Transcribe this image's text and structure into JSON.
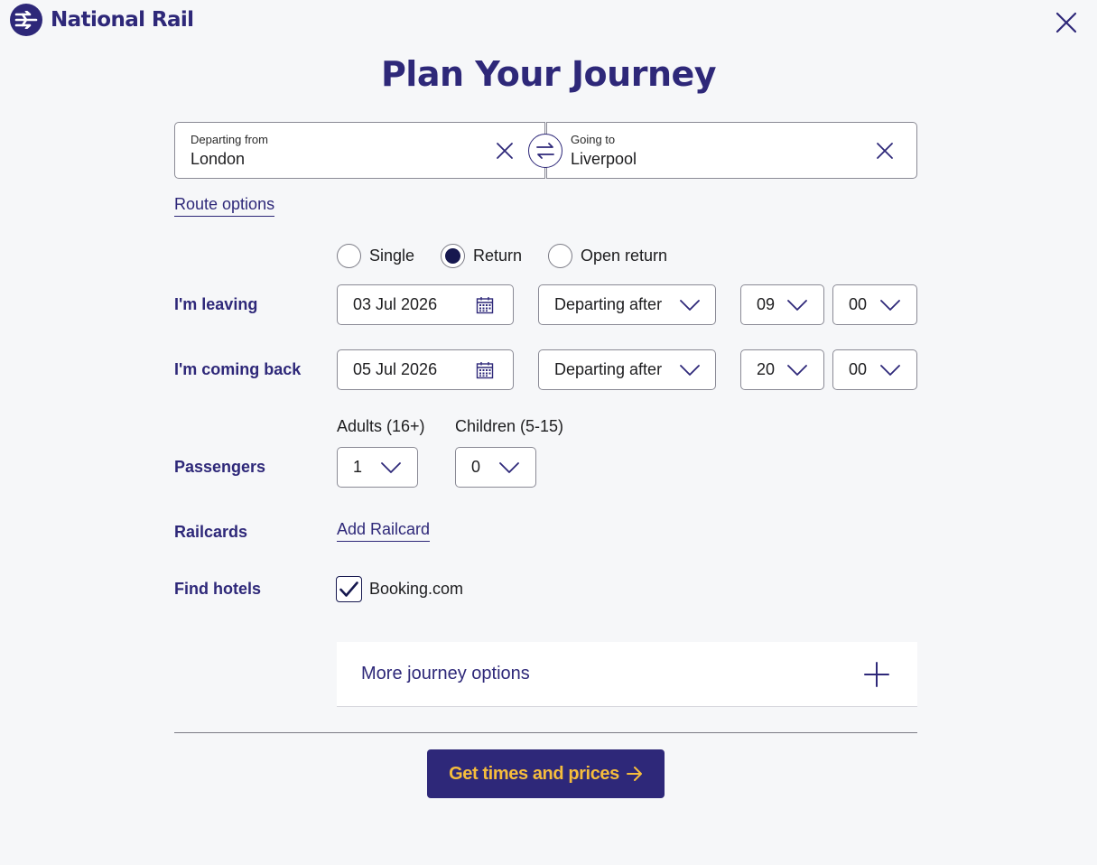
{
  "brand": {
    "name": "National Rail",
    "color": "#2e2879",
    "accent": "#f6bd3c"
  },
  "page": {
    "title": "Plan Your Journey"
  },
  "stations": {
    "from_label": "Departing from",
    "from_value": "London",
    "to_label": "Going to",
    "to_value": "Liverpool"
  },
  "route_options": "Route options",
  "ticket_types": {
    "single": "Single",
    "return": "Return",
    "open_return": "Open return",
    "selected": "Return"
  },
  "leaving": {
    "label": "I'm leaving",
    "date": "03 Jul 2026",
    "mode": "Departing after",
    "hour": "09",
    "minute": "00"
  },
  "coming_back": {
    "label": "I'm coming back",
    "date": "05 Jul 2026",
    "mode": "Departing after",
    "hour": "20",
    "minute": "00"
  },
  "passengers": {
    "label": "Passengers",
    "adults_label": "Adults (16+)",
    "adults_value": "1",
    "children_label": "Children (5-15)",
    "children_value": "0"
  },
  "railcards": {
    "label": "Railcards",
    "link": "Add Railcard"
  },
  "hotels": {
    "label": "Find hotels",
    "option": "Booking.com",
    "checked": true
  },
  "more_options": "More journey options",
  "cta": "Get times and prices",
  "icons": {
    "logo": "double-arrow-icon",
    "close": "close-icon",
    "swap": "swap-icon",
    "calendar": "calendar-icon",
    "dropdown": "chevron-down-icon",
    "check": "check-icon",
    "expand": "plus-icon",
    "cta": "arrow-right-icon"
  }
}
